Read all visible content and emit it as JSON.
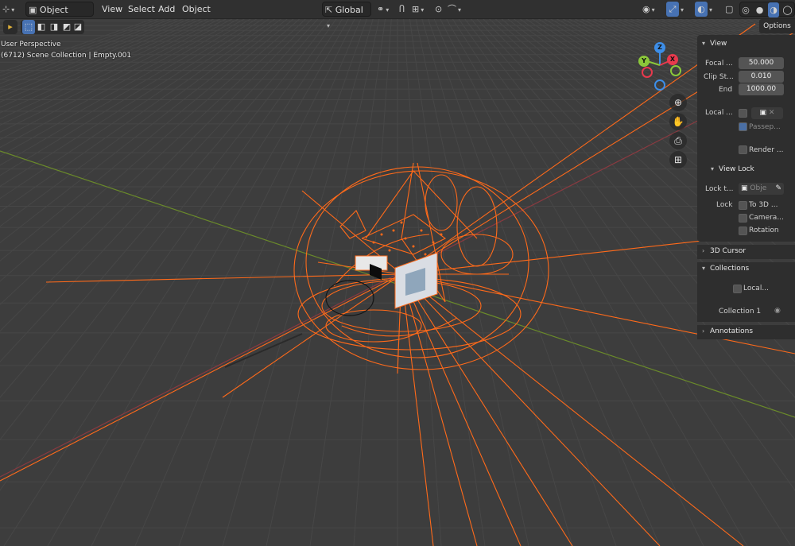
{
  "header": {
    "mode_label": "Object Mode",
    "menus": [
      "View",
      "Select",
      "Add",
      "Object"
    ],
    "transform_orientation": "Global"
  },
  "overlay": {
    "perspective": "User Perspective",
    "collection_info": "(6712) Scene Collection | Empty.001"
  },
  "gizmo": {
    "z": "Z",
    "y": "Y",
    "x": "X"
  },
  "options_tab": "Options",
  "sidebar": {
    "view_title": "View",
    "focal_label": "Focal ...",
    "focal_value": "50.000",
    "clip_start_label": "Clip St...",
    "clip_start_value": "0.010",
    "end_label": "End",
    "end_value": "1000.00",
    "local_label": "Local ...",
    "passepartout_label": "Passep...",
    "render_label": "Render ...",
    "view_lock_title": "View Lock",
    "lock_to_label": "Lock t...",
    "lock_object_placeholder": "Obje",
    "lock_label": "Lock",
    "to_3d_label": "To 3D ...",
    "camera_label": "Camera...",
    "rotation_label": "Rotation",
    "cursor_title": "3D Cursor",
    "collections_title": "Collections",
    "local_collections_label": "Local...",
    "collection_1": "Collection 1",
    "annotations_title": "Annotations"
  },
  "colors": {
    "viewport_bg": "#3d3d3d",
    "grid": "#494949",
    "x_axis": "#8a3a40",
    "y_axis": "#6a8a2a",
    "wire_selected": "#ff6a1a",
    "axis_x_ball": "#e8394d",
    "axis_y_ball": "#8bc83a",
    "axis_z_ball": "#3d8ee8"
  }
}
